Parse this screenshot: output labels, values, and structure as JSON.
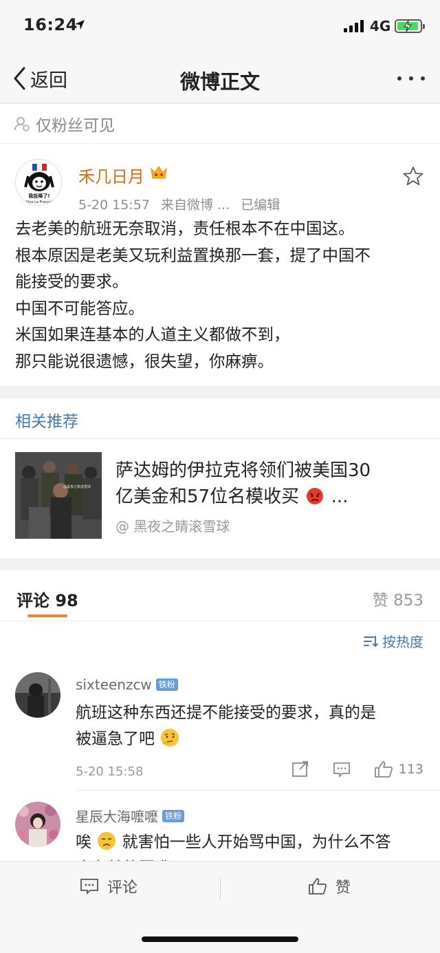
{
  "status_bar": {
    "time": "16:24",
    "network": "4G"
  },
  "nav": {
    "back_label": "返回",
    "title": "微博正文"
  },
  "visibility": {
    "label": "仅粉丝可见"
  },
  "post": {
    "author": "禾几日月",
    "date": "5-20 15:57",
    "source": "来自微博 ...",
    "edited": "已编辑",
    "avatar_caption": "我投降了!",
    "avatar_subcaption": "Vive La France!",
    "lines": [
      "去老美的航班无奈取消，责任根本不在中国这。",
      "根本原因是老美又玩利益置换那一套，提了中国不",
      "能接受的要求。",
      "中国不可能答应。",
      "米国如果连基本的人道主义都做不到，",
      "那只能说很遗憾，很失望，你麻痹。"
    ]
  },
  "related": {
    "section_title": "相关推荐",
    "headline_line1": "萨达姆的伊拉克将领们被美国30",
    "headline_line2": "亿美金和57位名模收买",
    "headline_suffix": "...",
    "source": "@ 黑夜之睛滚雪球",
    "thumb_watermark": "@黑夜之睛滚雪球"
  },
  "comments_header": {
    "tab_label": "评论 98",
    "likes_label": "赞 853"
  },
  "sort": {
    "label": "按热度"
  },
  "comments": [
    {
      "name": "sixteenzcw",
      "badge": "铁粉",
      "line1": "航班这种东西还提不能接受的要求，真的是",
      "line2": "被逼急了吧",
      "time": "5-20 15:58",
      "like_count": "113"
    },
    {
      "name": "星辰大海嚒嚒",
      "badge": "铁粉",
      "line1_pre": "唉",
      "line1_post": "就害怕一些人开始骂中国，为什么不答",
      "line2": "应老美的要求"
    }
  ],
  "bottom_bar": {
    "comment_label": "评论",
    "like_label": "赞"
  },
  "colors": {
    "author_orange": "#e2690e",
    "link_blue": "#4a78b0",
    "tab_underline": "#f5822a"
  }
}
